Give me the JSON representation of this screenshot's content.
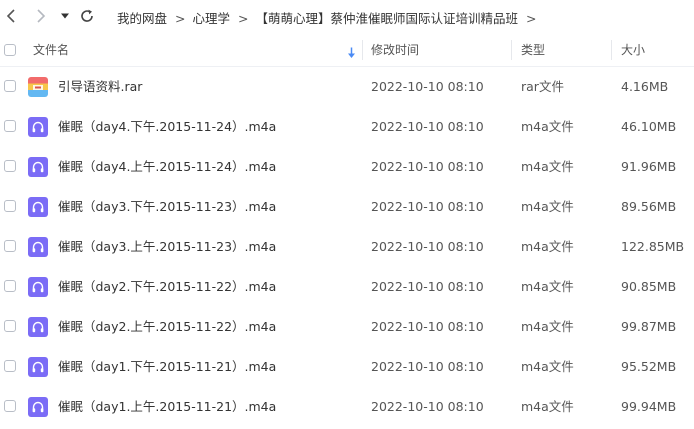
{
  "breadcrumb": {
    "items": [
      "我的网盘",
      "心理学",
      "【萌萌心理】蔡仲淮催眠师国际认证培训精品班"
    ],
    "separator": ">"
  },
  "icons": {
    "back": "chevron-left-icon",
    "forward": "chevron-right-icon",
    "history": "dropdown-triangle-icon",
    "refresh": "refresh-icon"
  },
  "header": {
    "name": "文件名",
    "modified": "修改时间",
    "type": "类型",
    "size": "大小",
    "sort_icon": "sort-down-arrow-icon"
  },
  "colors": {
    "accent": "#4b8bf5",
    "audio_icon": "#7b6cf6"
  },
  "files": [
    {
      "name": "引导语资料.rar",
      "modified": "2022-10-10 08:10",
      "type": "rar文件",
      "size": "4.16MB",
      "icon": "rar"
    },
    {
      "name": "催眠（day4.下午.2015-11-24）.m4a",
      "modified": "2022-10-10 08:10",
      "type": "m4a文件",
      "size": "46.10MB",
      "icon": "audio"
    },
    {
      "name": "催眠（day4.上午.2015-11-24）.m4a",
      "modified": "2022-10-10 08:10",
      "type": "m4a文件",
      "size": "91.96MB",
      "icon": "audio"
    },
    {
      "name": "催眠（day3.下午.2015-11-23）.m4a",
      "modified": "2022-10-10 08:10",
      "type": "m4a文件",
      "size": "89.56MB",
      "icon": "audio"
    },
    {
      "name": "催眠（day3.上午.2015-11-23）.m4a",
      "modified": "2022-10-10 08:10",
      "type": "m4a文件",
      "size": "122.85MB",
      "icon": "audio"
    },
    {
      "name": "催眠（day2.下午.2015-11-22）.m4a",
      "modified": "2022-10-10 08:10",
      "type": "m4a文件",
      "size": "90.85MB",
      "icon": "audio"
    },
    {
      "name": "催眠（day2.上午.2015-11-22）.m4a",
      "modified": "2022-10-10 08:10",
      "type": "m4a文件",
      "size": "99.87MB",
      "icon": "audio"
    },
    {
      "name": "催眠（day1.下午.2015-11-21）.m4a",
      "modified": "2022-10-10 08:10",
      "type": "m4a文件",
      "size": "95.52MB",
      "icon": "audio"
    },
    {
      "name": "催眠（day1.上午.2015-11-21）.m4a",
      "modified": "2022-10-10 08:10",
      "type": "m4a文件",
      "size": "99.94MB",
      "icon": "audio"
    }
  ]
}
